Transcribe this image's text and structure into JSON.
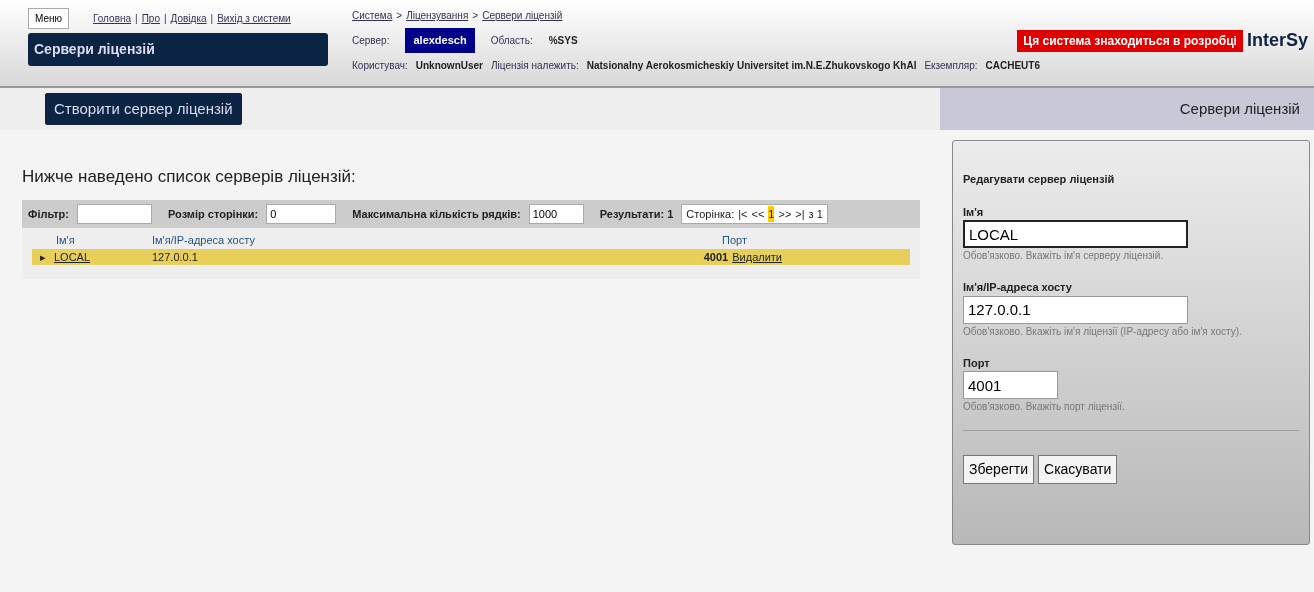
{
  "header": {
    "menu_button": "Меню",
    "links": [
      "Головна",
      "Про",
      "Довідка",
      "Вихід з системи"
    ],
    "link_separator": "|",
    "breadcrumb_separator": ">",
    "page_title": "Сервери ліцензій",
    "breadcrumb": [
      "Система",
      "Ліцензування",
      "Сервери ліцензій"
    ],
    "info": [
      {
        "label": "Сервер:",
        "value": "alexdesch",
        "kind": "boxed"
      },
      {
        "label": "Область:",
        "value": "%SYS",
        "kind": "bold"
      }
    ],
    "info2": [
      {
        "label": "Користувач:",
        "value": "UnknownUser"
      },
      {
        "label": "Ліцензія належить:",
        "value": "Natsionalny Aerokosmicheskiy Universitet im.N.E.Zhukovskogo KhAI"
      },
      {
        "label": "Екземпляр:",
        "value": "CACHEUT6"
      }
    ],
    "banner": "Ця система знаходиться в розробці",
    "logo": "InterSy"
  },
  "toolbar": {
    "create_button": "Створити сервер ліцензій",
    "tab": "Сервери ліцензій"
  },
  "heading": "Нижче наведено список серверів ліцензій:",
  "filter_bar": {
    "filter_label": "Фільтр:",
    "page_size_label": "Розмір сторінки:",
    "page_size": "0",
    "max_rows_label": "Максимальна кількість рядків:",
    "max_rows": "1000",
    "results": "Результати: 1",
    "page_label": "Сторінка:",
    "pager": [
      {
        "label": "|<",
        "selected": false
      },
      {
        "label": "<<",
        "selected": false
      },
      {
        "label": "1",
        "selected": true
      },
      {
        "label": ">>",
        "selected": false
      },
      {
        "label": ">|",
        "selected": false
      }
    ],
    "page_count": "з 1"
  },
  "table": {
    "columns": [
      "Ім'я",
      "Ім'я/IP-адреса хосту",
      "Порт"
    ],
    "rows": [
      {
        "marker": "▸",
        "name": "LOCAL",
        "host": "127.0.0.1",
        "port": "4001",
        "action": "Видалити",
        "selected": true
      }
    ]
  },
  "edit_panel": {
    "title": "Редагувати сервер ліцензій",
    "fields": [
      {
        "label": "Ім'я",
        "value": "LOCAL",
        "hint": "Обов'язково. Вкажіть ім'я серверу ліцензій.",
        "focused": true
      },
      {
        "label": "Ім'я/IP-адреса хосту",
        "value": "127.0.0.1",
        "hint": "Обов'язково. Вкажіть ім'я ліцензії (IP-адресу або ім'я хосту).",
        "focused": false
      },
      {
        "label": "Порт",
        "value": "4001",
        "hint": "Обов'язково. Вкажіть порт ліцензії.",
        "focused": false,
        "kind": "short"
      }
    ],
    "buttons": [
      "Зберегти",
      "Скасувати"
    ]
  }
}
